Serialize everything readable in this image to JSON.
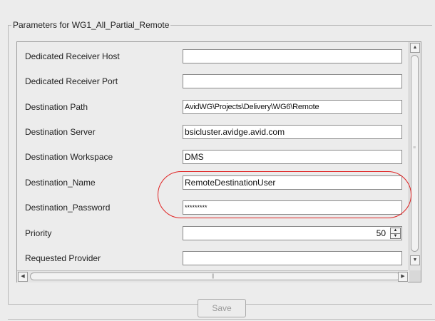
{
  "group": {
    "title": "Parameters for WG1_All_Partial_Remote"
  },
  "params": [
    {
      "label": "Dedicated Receiver Host",
      "value": ""
    },
    {
      "label": "Dedicated Receiver Port",
      "value": ""
    },
    {
      "label": "Destination Path",
      "value": "AvidWG\\Projects\\Delivery\\WG6\\Remote"
    },
    {
      "label": "Destination Server",
      "value": "bsicluster.avidge.avid.com"
    },
    {
      "label": "Destination Workspace",
      "value": "DMS"
    },
    {
      "label": "Destination_Name",
      "value": "RemoteDestinationUser"
    },
    {
      "label": "Destination_Password",
      "value": "*********"
    },
    {
      "label": "Priority",
      "value": "50"
    },
    {
      "label": "Requested Provider",
      "value": ""
    }
  ],
  "actions": {
    "save_label": "Save",
    "save_enabled": false
  },
  "annotation": {
    "color": "#e02424"
  },
  "icons": {
    "scroll_up": "scroll-up-arrow-icon",
    "scroll_down": "scroll-down-arrow-icon",
    "scroll_left": "scroll-left-arrow-icon",
    "scroll_right": "scroll-right-arrow-icon",
    "spin_up": "spin-up-arrow-icon",
    "spin_down": "spin-down-arrow-icon"
  }
}
